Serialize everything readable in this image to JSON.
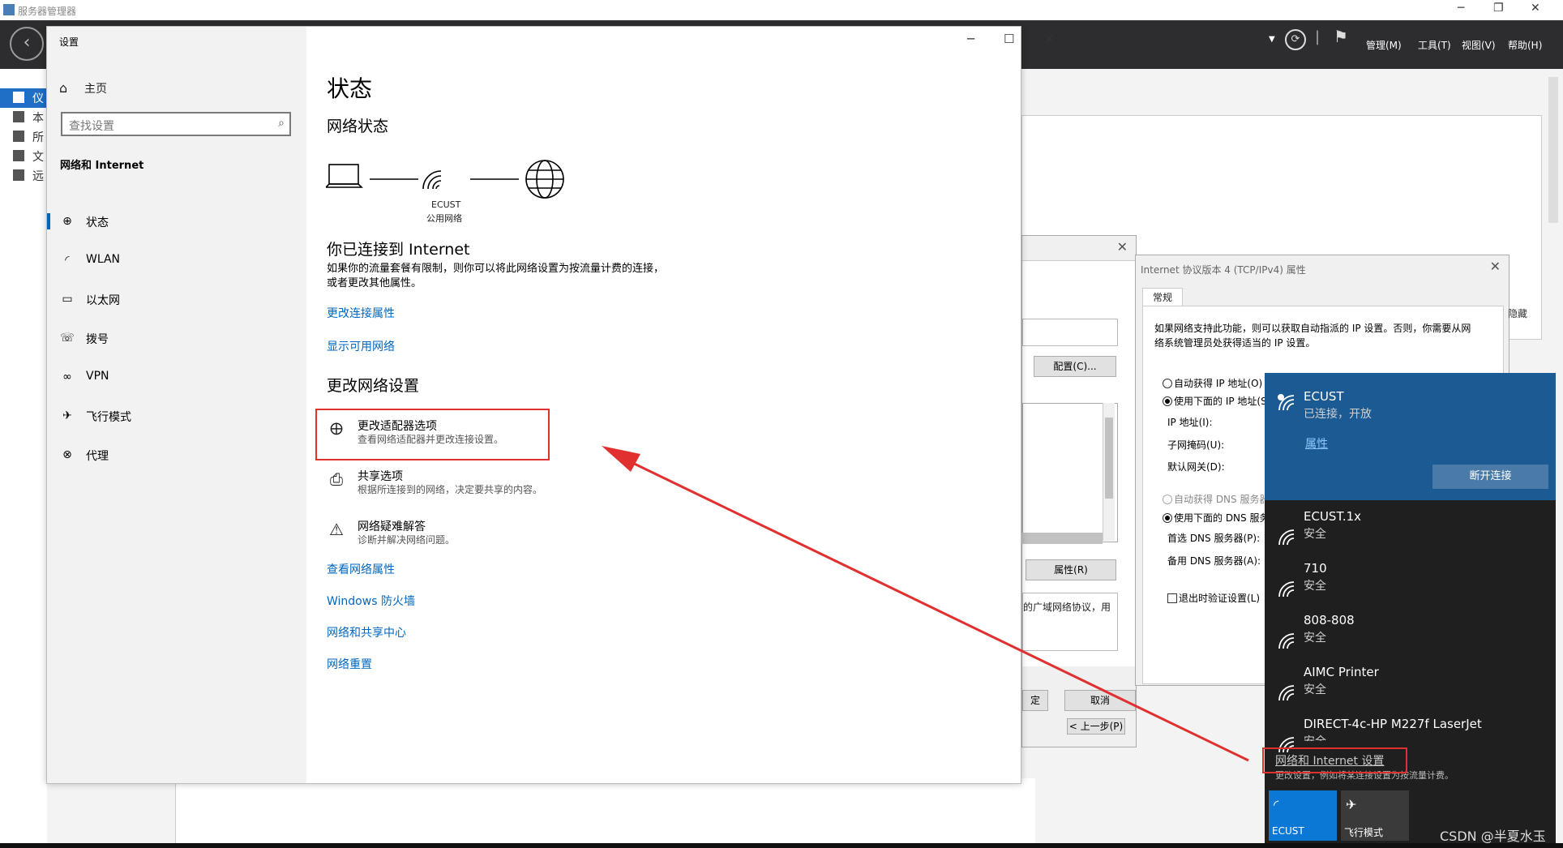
{
  "server_manager": {
    "title": "服务器管理器",
    "menus": [
      "管理(M)",
      "工具(T)",
      "视图(V)",
      "帮助(H)"
    ],
    "nav": [
      "仪",
      "本",
      "所",
      "文",
      "远"
    ]
  },
  "nc_dialog": {
    "configure_btn": "配置(C)...",
    "properties_btn": "属性(R)",
    "desc_fragment": "的广域网络协议，用",
    "ok_fragment": "定",
    "cancel_btn": "取消",
    "prev_btn": "< 上一步(P)"
  },
  "ipv4": {
    "title": "Internet 协议版本 4 (TCP/IPv4) 属性",
    "tab": "常规",
    "desc_line1": "如果网络支持此功能，则可以获取自动指派的 IP 设置。否则，你需要从网",
    "desc_line2": "络系统管理员处获得适当的 IP 设置。",
    "auto_ip": "自动获得 IP 地址(O)",
    "manual_ip": "使用下面的 IP 地址(S",
    "ip_address": "IP 地址(I):",
    "subnet": "子网掩码(U):",
    "gateway": "默认网关(D):",
    "auto_dns": "自动获得 DNS 服务器",
    "manual_dns": "使用下面的 DNS 服务",
    "pref_dns": "首选 DNS 服务器(P):",
    "alt_dns": "备用 DNS 服务器(A):",
    "validate": "退出时验证设置(L)",
    "extra_right": "隐藏"
  },
  "settings": {
    "window_title": "设置",
    "home": "主页",
    "search_placeholder": "查找设置",
    "section": "网络和 Internet",
    "nav": [
      {
        "label": "状态",
        "icon": "status-icon"
      },
      {
        "label": "WLAN",
        "icon": "wifi-icon"
      },
      {
        "label": "以太网",
        "icon": "ethernet-icon"
      },
      {
        "label": "拨号",
        "icon": "dialup-icon"
      },
      {
        "label": "VPN",
        "icon": "vpn-icon"
      },
      {
        "label": "飞行模式",
        "icon": "airplane-icon"
      },
      {
        "label": "代理",
        "icon": "proxy-icon"
      }
    ],
    "heading": "状态",
    "network_status": "网络状态",
    "network_name": "ECUST",
    "network_type": "公用网络",
    "connected_title": "你已连接到 Internet",
    "connected_desc": "如果你的流量套餐有限制，则你可以将此网络设置为按流量计费的连接，或者更改其他属性。",
    "link_change_props": "更改连接属性",
    "link_show_networks": "显示可用网络",
    "change_settings_title": "更改网络设置",
    "options": [
      {
        "title": "更改适配器选项",
        "desc": "查看网络适配器并更改连接设置。"
      },
      {
        "title": "共享选项",
        "desc": "根据所连接到的网络，决定要共享的内容。"
      },
      {
        "title": "网络疑难解答",
        "desc": "诊断并解决网络问题。"
      }
    ],
    "links": [
      "查看网络属性",
      "Windows 防火墙",
      "网络和共享中心",
      "网络重置"
    ]
  },
  "flyout": {
    "connected": {
      "ssid": "ECUST",
      "status": "已连接，开放",
      "properties": "属性",
      "disconnect": "断开连接"
    },
    "networks": [
      {
        "ssid": "ECUST.1x",
        "status": "安全"
      },
      {
        "ssid": "710",
        "status": "安全"
      },
      {
        "ssid": "808-808",
        "status": "安全"
      },
      {
        "ssid": "AIMC Printer",
        "status": "安全"
      },
      {
        "ssid": "DIRECT-4c-HP M227f LaserJet",
        "status": "安全"
      }
    ],
    "settings_link": "网络和 Internet 设置",
    "settings_desc": "更改设置，例如将某连接设置为按流量计费。",
    "tiles": [
      {
        "label": "ECUST",
        "active": true
      },
      {
        "label": "飞行模式",
        "active": false
      }
    ]
  },
  "watermark": "CSDN @半夏水玉",
  "colors": {
    "accent": "#0067c0",
    "flyout_selected": "#1c5a93",
    "annotation_red": "#e03030"
  }
}
